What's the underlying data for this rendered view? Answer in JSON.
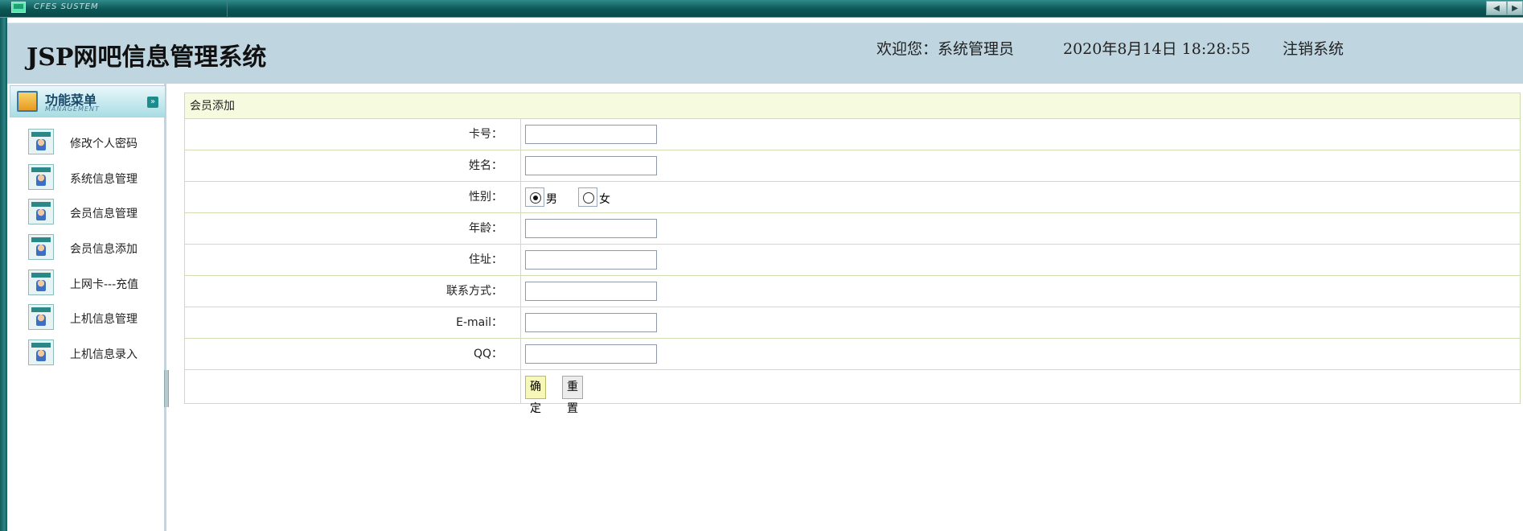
{
  "topbar": {
    "brand": "CFES SUSTEM",
    "prev_label": "◀",
    "next_label": "▶"
  },
  "header": {
    "title": "JSP网吧信息管理系统",
    "welcome": "欢迎您：系统管理员",
    "datetime": "2020年8月14日  18:28:55",
    "logout": "注销系统"
  },
  "sidebar": {
    "menu_title": "功能菜单",
    "menu_subtitle": "MANAGEMENT",
    "collapse_icon": "chevron-double-down-icon",
    "items": [
      {
        "label": "修改个人密码",
        "icon": "user-card-icon"
      },
      {
        "label": "系统信息管理",
        "icon": "user-card-icon"
      },
      {
        "label": "会员信息管理",
        "icon": "user-card-icon"
      },
      {
        "label": "会员信息添加",
        "icon": "user-card-icon"
      },
      {
        "label": "上网卡---充值",
        "icon": "user-card-icon"
      },
      {
        "label": "上机信息管理",
        "icon": "user-card-icon"
      },
      {
        "label": "上机信息录入",
        "icon": "user-card-icon"
      }
    ]
  },
  "form": {
    "title": "会员添加",
    "fields": {
      "card_no": {
        "label": "卡号：",
        "value": ""
      },
      "name": {
        "label": "姓名：",
        "value": ""
      },
      "gender": {
        "label": "性别：",
        "options": [
          "男",
          "女"
        ],
        "selected": "男"
      },
      "age": {
        "label": "年龄：",
        "value": ""
      },
      "address": {
        "label": "住址：",
        "value": ""
      },
      "contact": {
        "label": "联系方式：",
        "value": ""
      },
      "email": {
        "label": "E-mail：",
        "value": ""
      },
      "qq": {
        "label": "QQ：",
        "value": ""
      }
    },
    "submit_label": "确定",
    "reset_label": "重置"
  },
  "colors": {
    "topbar": "#0c5656",
    "header_bg": "#bfd5e0",
    "panel_title_bg": "#f6fbdf",
    "border": "#cfdcb4",
    "submit_bg": "#f7f7b8"
  }
}
